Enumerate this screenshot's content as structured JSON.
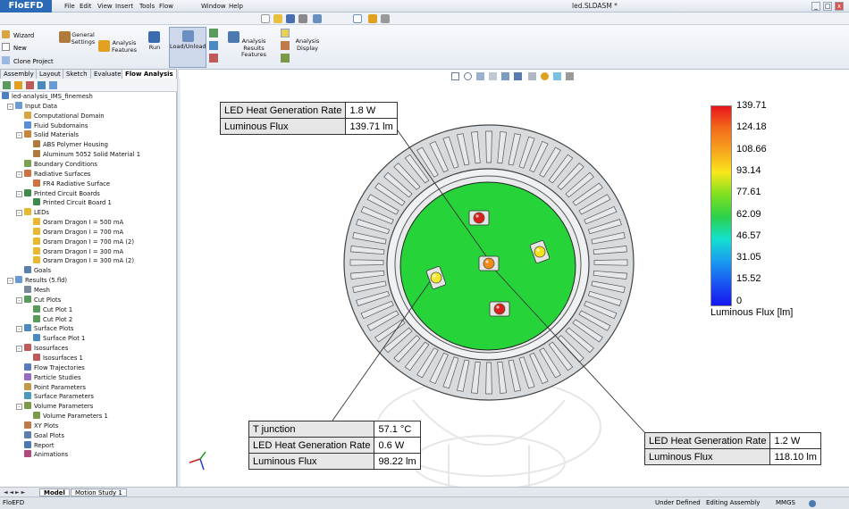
{
  "app": {
    "logo": "FloEFD",
    "document_title": "led.SLDASM *"
  },
  "menu": [
    "File",
    "Edit",
    "View",
    "Insert",
    "Tools",
    "Flow Analysis",
    "Window",
    "Help"
  ],
  "window_controls": [
    "_",
    "□",
    "x"
  ],
  "command_manager": {
    "left_items": [
      "Wizard",
      "New",
      "Clone Project"
    ],
    "buttons": [
      "General Settings",
      "Analysis Features",
      "Run",
      "Load/Unload",
      "Analysis Results Features",
      "Analysis Display"
    ]
  },
  "tabs": [
    {
      "label": "Assembly"
    },
    {
      "label": "Layout"
    },
    {
      "label": "Sketch"
    },
    {
      "label": "Evaluate"
    },
    {
      "label": "Flow Analysis",
      "active": true
    }
  ],
  "tree": [
    {
      "label": "led-analysis_IMS_finemesh",
      "level": 0,
      "icon": "project-icon",
      "color": "#4a7fc1"
    },
    {
      "label": "Input Data",
      "level": 1,
      "icon": "folder-icon",
      "color": "#6a9ad4",
      "expander": "-"
    },
    {
      "label": "Computational Domain",
      "level": 2,
      "icon": "domain-icon",
      "color": "#d9a441"
    },
    {
      "label": "Fluid Subdomains",
      "level": 2,
      "icon": "fluid-icon",
      "color": "#5a8fd8"
    },
    {
      "label": "Solid Materials",
      "level": 2,
      "icon": "material-icon",
      "color": "#c8843a",
      "expander": "-"
    },
    {
      "label": "ABS Polymer Housing",
      "level": 3,
      "icon": "solid-icon",
      "color": "#b07a3c"
    },
    {
      "label": "Aluminum 5052 Solid Material 1",
      "level": 3,
      "icon": "solid-icon",
      "color": "#b07a3c"
    },
    {
      "label": "Boundary Conditions",
      "level": 2,
      "icon": "boundary-icon",
      "color": "#7ba34e"
    },
    {
      "label": "Radiative Surfaces",
      "level": 2,
      "icon": "radiative-icon",
      "color": "#d07040",
      "expander": "-"
    },
    {
      "label": "FR4 Radiative Surface",
      "level": 3,
      "icon": "surface-icon",
      "color": "#d07040"
    },
    {
      "label": "Printed Circuit Boards",
      "level": 2,
      "icon": "pcb-icon",
      "color": "#3d8a4a",
      "expander": "-"
    },
    {
      "label": "Printed Circuit Board 1",
      "level": 3,
      "icon": "pcb-icon",
      "color": "#3d8a4a"
    },
    {
      "label": "LEDs",
      "level": 2,
      "icon": "led-icon",
      "color": "#e8b830",
      "expander": "-"
    },
    {
      "label": "Osram Dragon I = 500 mA",
      "level": 3,
      "icon": "led-icon",
      "color": "#e8b830"
    },
    {
      "label": "Osram Dragon I = 700 mA",
      "level": 3,
      "icon": "led-icon",
      "color": "#e8b830"
    },
    {
      "label": "Osram Dragon I = 700 mA (2)",
      "level": 3,
      "icon": "led-icon",
      "color": "#e8b830"
    },
    {
      "label": "Osram Dragon I = 300 mA",
      "level": 3,
      "icon": "led-icon",
      "color": "#e8b830"
    },
    {
      "label": "Osram Dragon I = 300 mA (2)",
      "level": 3,
      "icon": "led-icon",
      "color": "#e8b830"
    },
    {
      "label": "Goals",
      "level": 2,
      "icon": "goals-icon",
      "color": "#5c7fb0"
    },
    {
      "label": "Results (5.fld)",
      "level": 1,
      "icon": "results-icon",
      "color": "#6a9ad4",
      "expander": "-"
    },
    {
      "label": "Mesh",
      "level": 2,
      "icon": "mesh-icon",
      "color": "#7a8a9a"
    },
    {
      "label": "Cut Plots",
      "level": 2,
      "icon": "cutplot-icon",
      "color": "#5a9a5a",
      "expander": "-"
    },
    {
      "label": "Cut Plot 1",
      "level": 3,
      "icon": "plot-icon",
      "color": "#5a9a5a"
    },
    {
      "label": "Cut Plot 2",
      "level": 3,
      "icon": "plot-icon",
      "color": "#5a9a5a"
    },
    {
      "label": "Surface Plots",
      "level": 2,
      "icon": "surfaceplot-icon",
      "color": "#4a8ac0",
      "expander": "-"
    },
    {
      "label": "Surface Plot 1",
      "level": 3,
      "icon": "plot-icon",
      "color": "#4a8ac0"
    },
    {
      "label": "Isosurfaces",
      "level": 2,
      "icon": "isosurface-icon",
      "color": "#c05a5a",
      "expander": "-"
    },
    {
      "label": "Isosurfaces 1",
      "level": 3,
      "icon": "plot-icon",
      "color": "#c05a5a"
    },
    {
      "label": "Flow Trajectories",
      "level": 2,
      "icon": "trajectory-icon",
      "color": "#5a7ac0"
    },
    {
      "label": "Particle Studies",
      "level": 2,
      "icon": "particle-icon",
      "color": "#9a6ac0"
    },
    {
      "label": "Point Parameters",
      "level": 2,
      "icon": "point-icon",
      "color": "#c09a4a"
    },
    {
      "label": "Surface Parameters",
      "level": 2,
      "icon": "surfaceparam-icon",
      "color": "#4a9ac0"
    },
    {
      "label": "Volume Parameters",
      "level": 2,
      "icon": "volume-icon",
      "color": "#7a9a4a",
      "expander": "-"
    },
    {
      "label": "Volume Parameters 1",
      "level": 3,
      "icon": "volume-icon",
      "color": "#7a9a4a"
    },
    {
      "label": "XY Plots",
      "level": 2,
      "icon": "xyplot-icon",
      "color": "#c07a4a"
    },
    {
      "label": "Goal Plots",
      "level": 2,
      "icon": "goalplot-icon",
      "color": "#5c7fb0"
    },
    {
      "label": "Report",
      "level": 2,
      "icon": "report-icon",
      "color": "#4a7ab0"
    },
    {
      "label": "Animations",
      "level": 2,
      "icon": "animation-icon",
      "color": "#b04a7a"
    }
  ],
  "bottom_tabs": [
    "Model",
    "Motion Study 1"
  ],
  "status": {
    "left": "FloEFD",
    "under_defined": "Under Defined",
    "editing": "Editing Assembly",
    "units": "MMGS"
  },
  "callouts": {
    "top": [
      {
        "label": "LED Heat Generation Rate",
        "value": "1.8 W"
      },
      {
        "label": "Luminous Flux",
        "value": "139.71 lm"
      }
    ],
    "bottom_left": [
      {
        "label": "T junction",
        "value": "57.1 °C"
      },
      {
        "label": "LED Heat Generation Rate",
        "value": "0.6 W"
      },
      {
        "label": "Luminous Flux",
        "value": "98.22 lm"
      }
    ],
    "bottom_right": [
      {
        "label": "LED Heat Generation Rate",
        "value": "1.2 W"
      },
      {
        "label": "Luminous Flux",
        "value": "118.10 lm"
      }
    ]
  },
  "legend": {
    "title": "Luminous Flux [lm]",
    "ticks": [
      "139.71",
      "124.18",
      "108.66",
      "93.14",
      "77.61",
      "62.09",
      "46.57",
      "31.05",
      "15.52",
      "0"
    ],
    "colors": [
      "#e8141c",
      "#f26b1a",
      "#f7a41d",
      "#f8e71c",
      "#7ee01f",
      "#2bd14a",
      "#14e0d0",
      "#1a9cf0",
      "#1a55f0",
      "#1414f0"
    ]
  },
  "leds": [
    {
      "name": "led-top",
      "color": "#d92020"
    },
    {
      "name": "led-center",
      "color": "#f08a1a"
    },
    {
      "name": "led-right",
      "color": "#f2e21c"
    },
    {
      "name": "led-left",
      "color": "#f5e830"
    },
    {
      "name": "led-bottom",
      "color": "#d92020"
    }
  ],
  "colors": {
    "board": "#26d43a",
    "ring": "#bfc3c8",
    "fin": "#e6e8ea"
  }
}
